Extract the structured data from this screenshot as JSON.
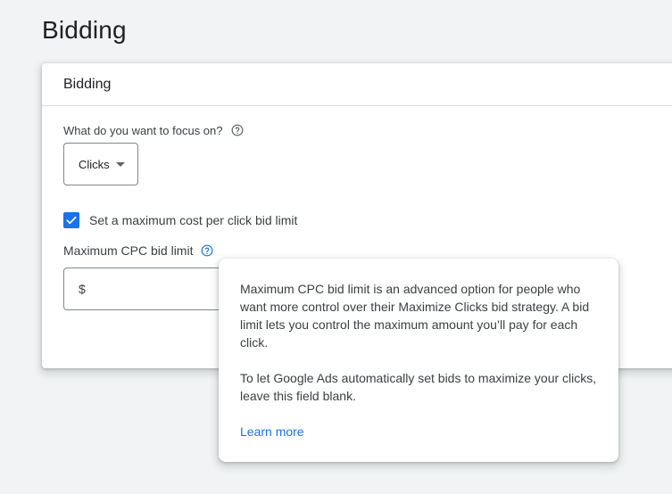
{
  "page": {
    "title": "Bidding"
  },
  "card": {
    "title": "Bidding",
    "focus": {
      "label": "What do you want to focus on?",
      "selected": "Clicks"
    },
    "max_cpc_checkbox": {
      "label": "Set a maximum cost per click bid limit",
      "checked": true
    },
    "max_cpc": {
      "label": "Maximum CPC bid limit",
      "currency_symbol": "$",
      "value": ""
    }
  },
  "tooltip": {
    "paragraph1": "Maximum CPC bid limit is an advanced option for people who want more control over their Maximize Clicks bid strategy. A bid limit lets you control the maximum amount you’ll pay for each click.",
    "paragraph2": "To let Google Ads automatically set bids to maximize your clicks, leave this field blank.",
    "link": "Learn more"
  },
  "colors": {
    "accent": "#1a73e8",
    "background": "#f1f3f4",
    "text": "#202124",
    "border": "#80868b"
  },
  "icons": {
    "help": "help-circle-icon",
    "checkmark": "checkmark-icon",
    "dropdown": "caret-down-icon"
  }
}
